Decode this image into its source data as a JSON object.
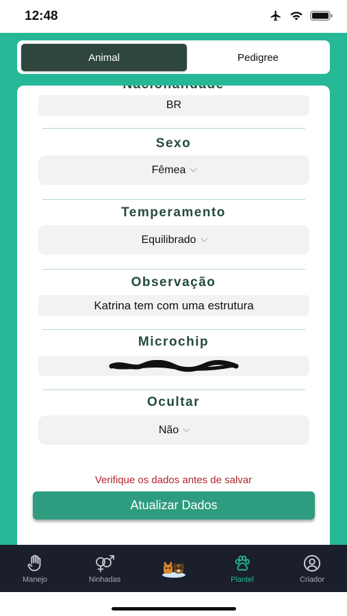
{
  "status_bar": {
    "time": "12:48"
  },
  "segments": {
    "animal": "Animal",
    "pedigree": "Pedigree"
  },
  "form": {
    "nacionalidade": {
      "value": "BR"
    },
    "sexo": {
      "label": "Sexo",
      "value": "Fêmea"
    },
    "temperamento": {
      "label": "Temperamento",
      "value": "Equilibrado"
    },
    "observacao": {
      "label": "Observação",
      "value": "Katrina tem com uma estrutura"
    },
    "microchip": {
      "label": "Microchip"
    },
    "ocultar": {
      "label": "Ocultar",
      "value": "Não"
    }
  },
  "warning": "Verifique os dados antes de salvar",
  "update_button": "Atualizar Dados",
  "tabs": [
    {
      "label": "Manejo",
      "icon": "hand-icon"
    },
    {
      "label": "Ninhadas",
      "icon": "gender-icon"
    },
    {
      "label": "",
      "icon": "pets-logo-icon"
    },
    {
      "label": "Plantel",
      "icon": "paw-icon"
    },
    {
      "label": "Criador",
      "icon": "user-circle-icon"
    }
  ],
  "colors": {
    "accent": "#26b896",
    "dark": "#2f463f",
    "tabbar": "#1a1f2b",
    "warning": "#b3262c",
    "button": "#2e9c7e"
  }
}
